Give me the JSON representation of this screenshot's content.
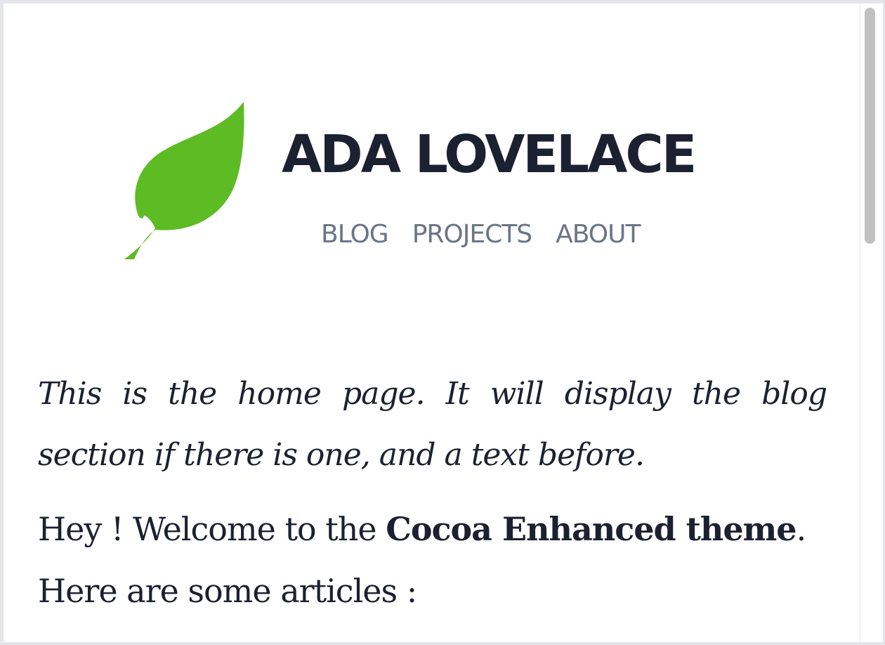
{
  "site": {
    "title": "ADA LOVELACE",
    "logo_icon": "leaf-icon",
    "logo_color": "#5dbb24"
  },
  "nav": {
    "items": [
      {
        "label": "BLOG"
      },
      {
        "label": "PROJECTS"
      },
      {
        "label": "ABOUT"
      }
    ]
  },
  "main": {
    "intro": "This is the home page. It will display the blog section if there is one, and a text before.",
    "welcome_prefix": "Hey ! Welcome to the ",
    "welcome_theme": "Cocoa Enhanced theme",
    "welcome_suffix": ".",
    "welcome_line2": "Here are some articles :"
  },
  "colors": {
    "title": "#1b2130",
    "nav": "#6a7587",
    "text": "#1b2130",
    "border": "#e3e5e8"
  }
}
